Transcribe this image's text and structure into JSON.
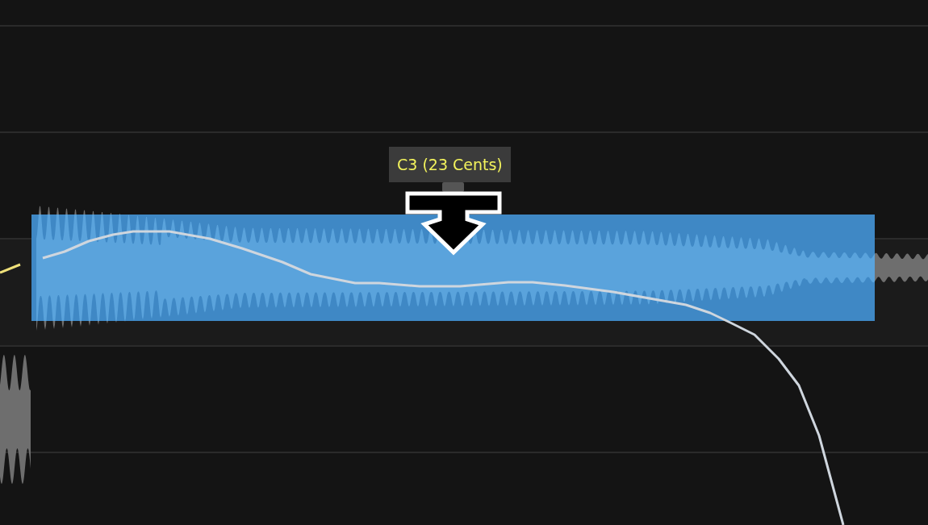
{
  "note": {
    "selected": true,
    "pitch_tooltip": "C3 (23 Cents)"
  }
}
